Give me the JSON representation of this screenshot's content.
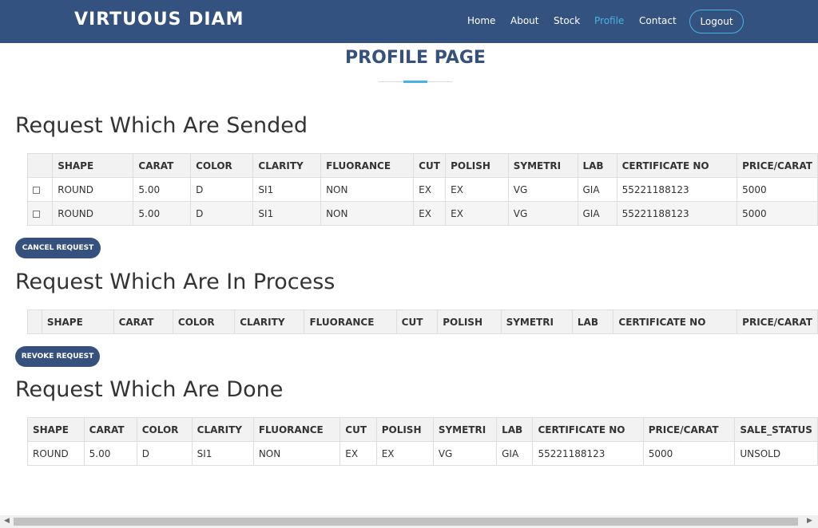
{
  "navbar": {
    "brand": "VIRTUOUS DIAM",
    "items": [
      "Home",
      "About",
      "Stock",
      "Profile",
      "Contact"
    ],
    "active": "Profile",
    "logout_label": "Logout"
  },
  "page_title": "PROFILE PAGE",
  "sections": {
    "sended": {
      "heading": "Request Which Are Sended",
      "columns": [
        "SHAPE",
        "CARAT",
        "COLOR",
        "CLARITY",
        "FLUORANCE",
        "CUT",
        "POLISH",
        "SYMETRI",
        "LAB",
        "CERTIFICATE NO",
        "PRICE/CARAT"
      ],
      "rows": [
        [
          "ROUND",
          "5.00",
          "D",
          "SI1",
          "NON",
          "EX",
          "EX",
          "VG",
          "GIA",
          "55221188123",
          "5000"
        ],
        [
          "ROUND",
          "5.00",
          "D",
          "SI1",
          "NON",
          "EX",
          "EX",
          "VG",
          "GIA",
          "55221188123",
          "5000"
        ]
      ],
      "button_label": "CANCEL REQUEST"
    },
    "process": {
      "heading": "Request Which Are In Process",
      "columns": [
        "SHAPE",
        "CARAT",
        "COLOR",
        "CLARITY",
        "FLUORANCE",
        "CUT",
        "POLISH",
        "SYMETRI",
        "LAB",
        "CERTIFICATE NO",
        "PRICE/CARAT"
      ],
      "rows": [],
      "button_label": "REVOKE REQUEST"
    },
    "done": {
      "heading": "Request Which Are Done",
      "columns": [
        "SHAPE",
        "CARAT",
        "COLOR",
        "CLARITY",
        "FLUORANCE",
        "CUT",
        "POLISH",
        "SYMETRI",
        "LAB",
        "CERTIFICATE NO",
        "PRICE/CARAT",
        "SALE_STATUS"
      ],
      "rows": [
        [
          "ROUND",
          "5.00",
          "D",
          "SI1",
          "NON",
          "EX",
          "EX",
          "VG",
          "GIA",
          "55221188123",
          "5000",
          "UNSOLD"
        ]
      ]
    }
  },
  "colors": {
    "navbar_bg": "#34527f",
    "accent": "#47b2e4",
    "button_bg": "#37517e"
  }
}
